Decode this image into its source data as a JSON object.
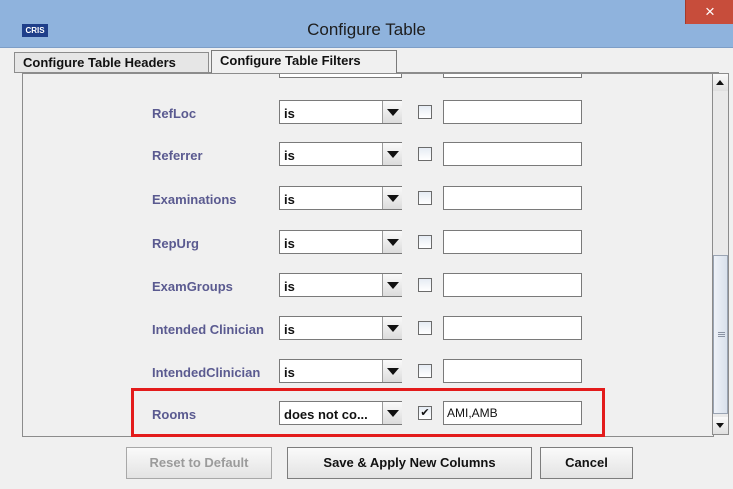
{
  "window": {
    "icon_text": "CRIS",
    "title": "Configure Table",
    "close_glyph": "×"
  },
  "tabs": [
    {
      "label": "Configure Table Headers",
      "active": false
    },
    {
      "label": "Configure Table Filters",
      "active": true
    }
  ],
  "filters": [
    {
      "label": "RefLoc",
      "operator": "is",
      "checked": "",
      "value": ""
    },
    {
      "label": "Referrer",
      "operator": "is",
      "checked": "",
      "value": ""
    },
    {
      "label": "Examinations",
      "operator": "is",
      "checked": "",
      "value": ""
    },
    {
      "label": "RepUrg",
      "operator": "is",
      "checked": "",
      "value": ""
    },
    {
      "label": "ExamGroups",
      "operator": "is",
      "checked": "",
      "value": ""
    },
    {
      "label": "Intended Clinician",
      "operator": "is",
      "checked": "",
      "value": ""
    },
    {
      "label": "IntendedClinician",
      "operator": "is",
      "checked": "",
      "value": ""
    },
    {
      "label": "Rooms",
      "operator": "does not co...",
      "checked": "✔",
      "value": "AMI,AMB"
    }
  ],
  "highlight_color": "#e31b1b",
  "footer": {
    "reset_label": "Reset to Default",
    "save_label": "Save & Apply New Columns",
    "cancel_label": "Cancel"
  }
}
